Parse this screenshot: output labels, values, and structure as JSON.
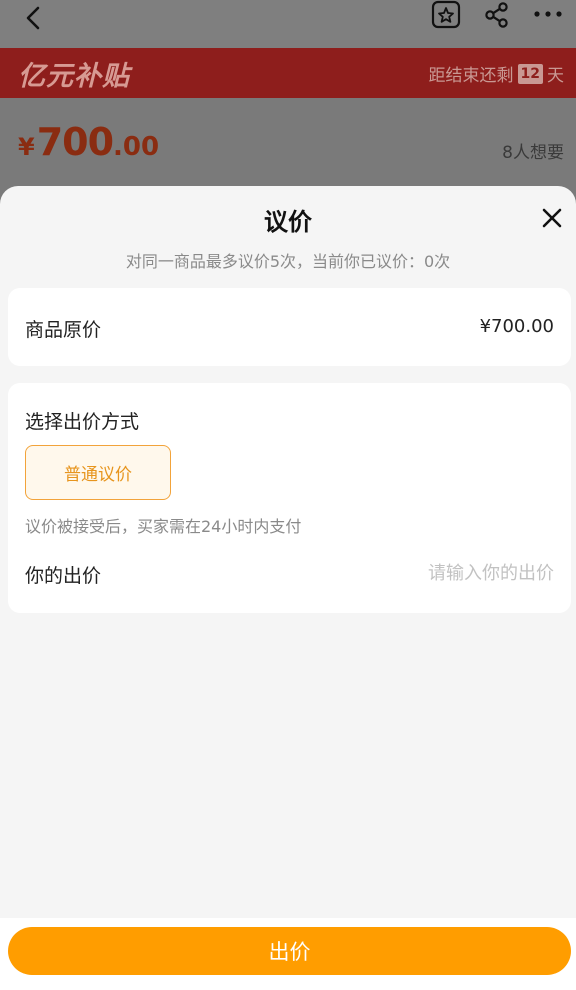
{
  "topbar": {
    "icons": [
      "back-arrow-icon",
      "favorite-star-icon",
      "share-icon",
      "more-icon"
    ]
  },
  "banner": {
    "brand": "亿元补贴",
    "countdown_prefix": "距结束还剩",
    "countdown_days": "12",
    "countdown_suffix": "天"
  },
  "product": {
    "price_symbol": "¥",
    "price_int": "700",
    "price_dec": ".00",
    "wants": "8人想要"
  },
  "sheet": {
    "title": "议价",
    "subtitle": "对同一商品最多议价5次，当前你已议价：0次",
    "original_price_label": "商品原价",
    "original_price_value": "¥700.00",
    "method_label": "选择出价方式",
    "method_option": "普通议价",
    "hint": "议价被接受后，买家需在24小时内支付",
    "bid_label": "你的出价",
    "bid_placeholder": "请输入你的出价",
    "submit_label": "出价"
  },
  "colors": {
    "accent": "#ff9d00",
    "option_border": "#f2a33a",
    "banner_red": "#8e1e1c"
  }
}
